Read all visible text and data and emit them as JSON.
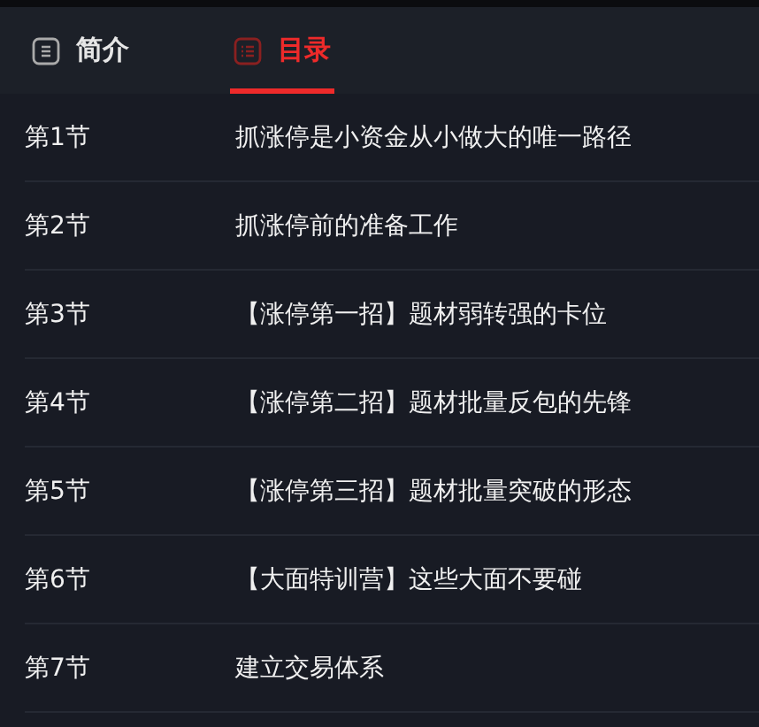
{
  "tabs": [
    {
      "label": "简介",
      "selected": false
    },
    {
      "label": "目录",
      "selected": true
    }
  ],
  "chapters": [
    {
      "number": "第1节",
      "title": "抓涨停是小资金从小做大的唯一路径"
    },
    {
      "number": "第2节",
      "title": "抓涨停前的准备工作"
    },
    {
      "number": "第3节",
      "title": "【涨停第一招】题材弱转强的卡位"
    },
    {
      "number": "第4节",
      "title": "【涨停第二招】题材批量反包的先锋"
    },
    {
      "number": "第5节",
      "title": "【涨停第三招】题材批量突破的形态"
    },
    {
      "number": "第6节",
      "title": "【大面特训营】这些大面不要碰"
    },
    {
      "number": "第7节",
      "title": "建立交易体系"
    }
  ]
}
